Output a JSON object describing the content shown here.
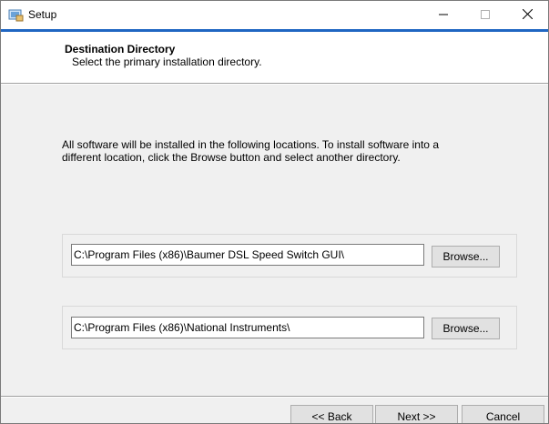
{
  "window": {
    "title": "Setup",
    "icon": "setup-icon",
    "controls": {
      "minimize": "–",
      "maximize": "☐",
      "close": "✕"
    },
    "accent_color": "#1f66c2"
  },
  "header": {
    "title": "Destination Directory",
    "subtitle": "Select the primary installation directory."
  },
  "body": {
    "description": "All software will be installed in the following locations. To install software into a different location, click the Browse button and select another directory."
  },
  "locations": [
    {
      "path": "C:\\Program Files (x86)\\Baumer DSL Speed Switch GUI\\",
      "browse_label": "Browse..."
    },
    {
      "path": "C:\\Program Files (x86)\\National Instruments\\",
      "browse_label": "Browse..."
    }
  ],
  "footer": {
    "back_label": "<< Back",
    "next_label": "Next >>",
    "cancel_label": "Cancel"
  }
}
